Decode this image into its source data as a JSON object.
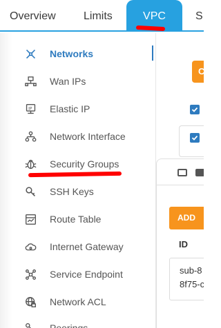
{
  "tabs": [
    {
      "label": "Overview"
    },
    {
      "label": "Limits"
    },
    {
      "label": "VPC"
    },
    {
      "label": "S"
    }
  ],
  "sidebar": {
    "items": [
      {
        "label": "Networks",
        "icon": "network-icon",
        "active": true
      },
      {
        "label": "Wan IPs",
        "icon": "wan-icon"
      },
      {
        "label": "Elastic IP",
        "icon": "elastic-ip-icon"
      },
      {
        "label": "Network Interface",
        "icon": "network-interface-icon"
      },
      {
        "label": "Security Groups",
        "icon": "bug-icon"
      },
      {
        "label": "SSH Keys",
        "icon": "key-icon"
      },
      {
        "label": "Route Table",
        "icon": "route-table-icon"
      },
      {
        "label": "Internet Gateway",
        "icon": "cloud-gateway-icon"
      },
      {
        "label": "Service Endpoint",
        "icon": "service-endpoint-icon"
      },
      {
        "label": "Network ACL",
        "icon": "globe-lock-icon"
      },
      {
        "label": "Peerings",
        "icon": "peering-icon"
      }
    ]
  },
  "content": {
    "top_button_label": "C",
    "add_button_label": "ADD",
    "table_header_id": "ID",
    "id_line1": "sub-8",
    "id_line2": "8f75-c"
  },
  "colors": {
    "accent": "#27a1e0",
    "active_text": "#2e7bbf",
    "orange": "#f7941d",
    "annotation": "#ff0000"
  }
}
